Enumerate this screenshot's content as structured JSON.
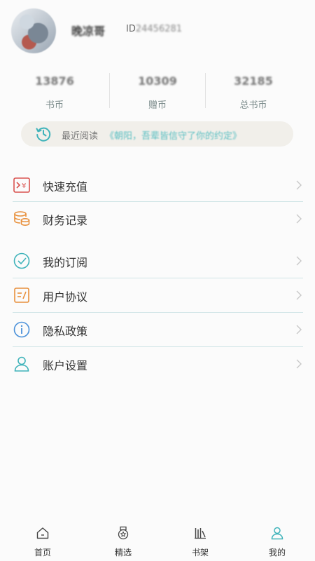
{
  "profile": {
    "username": "晚凉哥",
    "id_prefix": "ID",
    "id_value": "24456281"
  },
  "stats": [
    {
      "value": "13876",
      "label": "书币"
    },
    {
      "value": "10309",
      "label": "赠币"
    },
    {
      "value": "32185",
      "label": "总书币"
    }
  ],
  "recent": {
    "label": "最近阅读",
    "title": "《朝阳，吾辈皆信守了你的约定》"
  },
  "menu": [
    {
      "label": "快速充值",
      "icon": "recharge-icon"
    },
    {
      "label": "财务记录",
      "icon": "coins-icon"
    },
    {
      "label": "我的订阅",
      "icon": "subscription-check-icon"
    },
    {
      "label": "用户协议",
      "icon": "agreement-icon"
    },
    {
      "label": "隐私政策",
      "icon": "info-icon"
    },
    {
      "label": "账户设置",
      "icon": "user-icon"
    }
  ],
  "tabs": [
    {
      "label": "首页",
      "icon": "home-icon"
    },
    {
      "label": "精选",
      "icon": "medal-icon"
    },
    {
      "label": "书架",
      "icon": "bookshelf-icon"
    },
    {
      "label": "我的",
      "icon": "profile-icon",
      "active": true
    }
  ],
  "colors": {
    "accent": "#3fb3ba",
    "recharge": "#d9534f",
    "finance": "#e8903c",
    "divider": "#cfe4e6"
  }
}
